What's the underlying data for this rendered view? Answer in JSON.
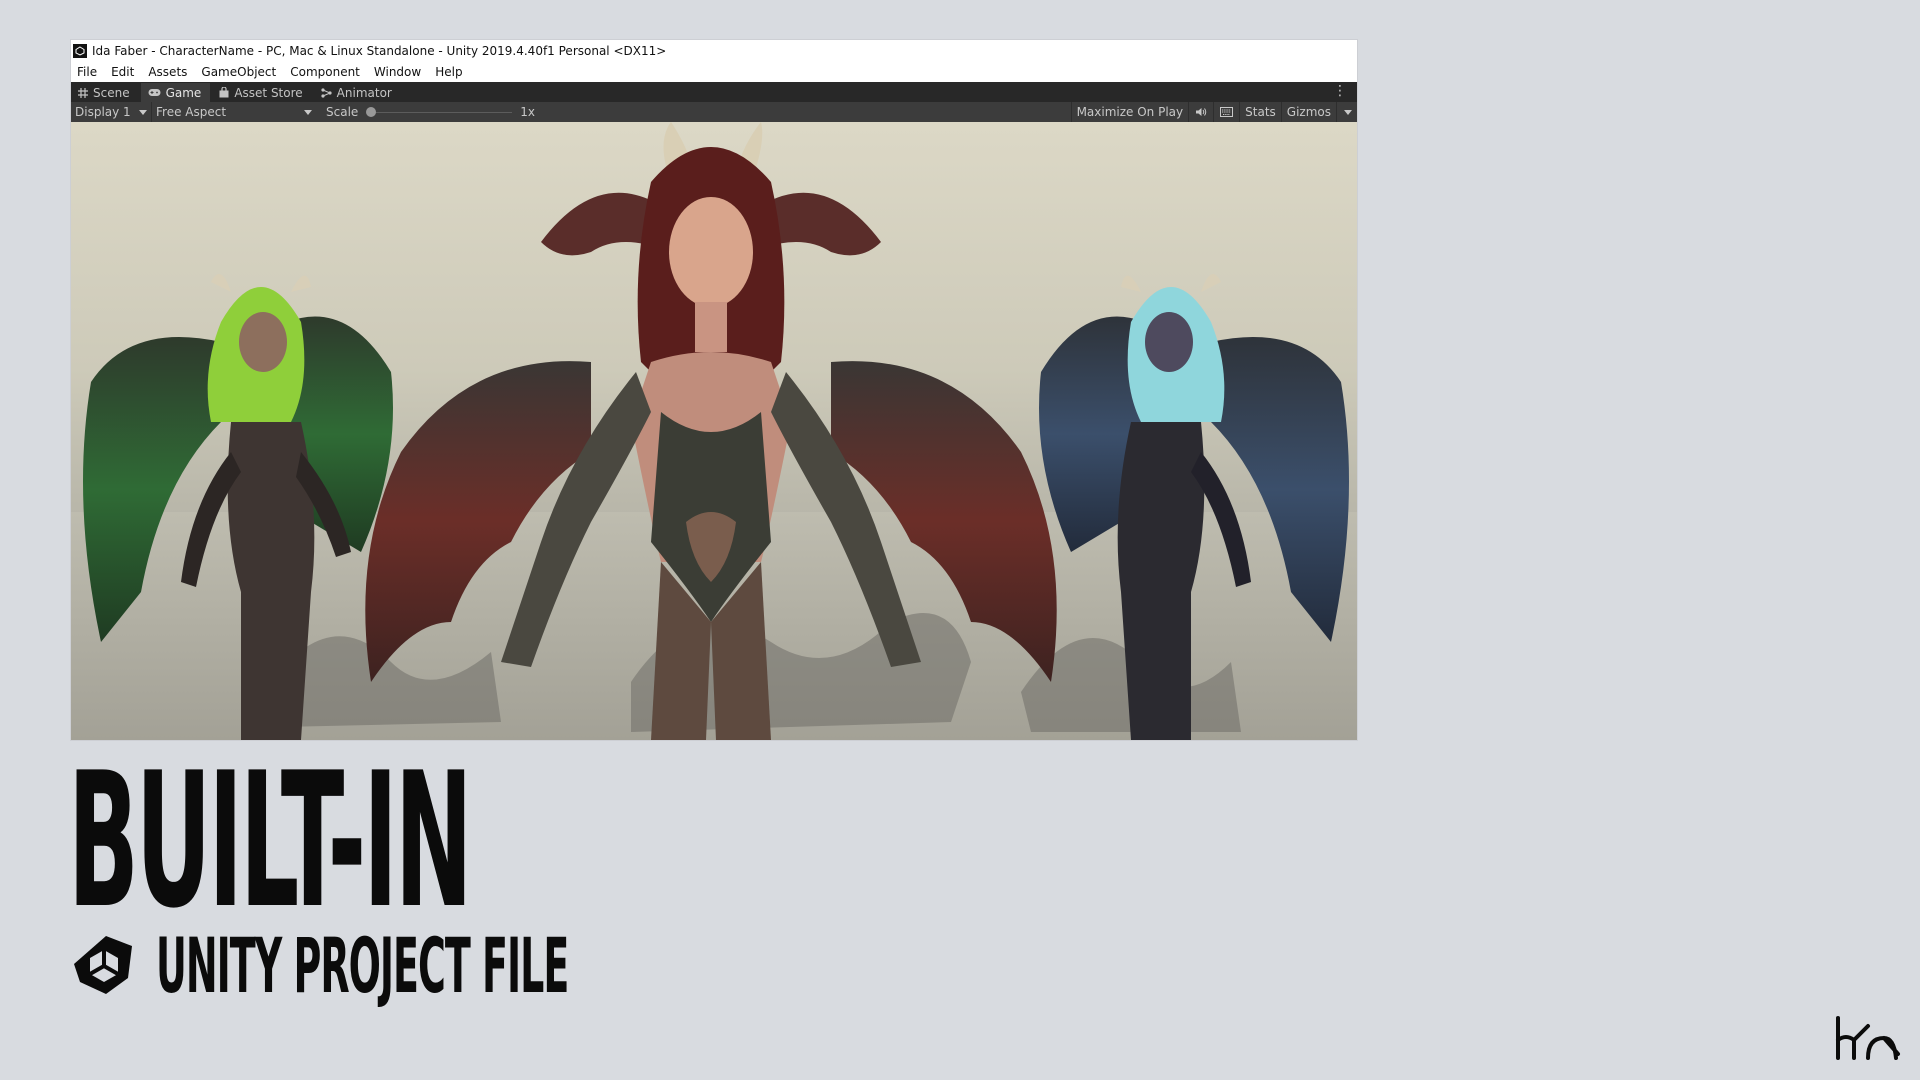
{
  "window": {
    "title": "Ida Faber - CharacterName - PC, Mac & Linux Standalone - Unity 2019.4.40f1 Personal <DX11>"
  },
  "menu": [
    "File",
    "Edit",
    "Assets",
    "GameObject",
    "Component",
    "Window",
    "Help"
  ],
  "tabs": [
    {
      "label": "Scene",
      "icon": "scene-grid-icon",
      "active": false
    },
    {
      "label": "Game",
      "icon": "gamepad-icon",
      "active": true
    },
    {
      "label": "Asset Store",
      "icon": "bag-icon",
      "active": false
    },
    {
      "label": "Animator",
      "icon": "animator-icon",
      "active": false
    }
  ],
  "toolbar": {
    "display": "Display 1",
    "aspect": "Free Aspect",
    "scale_label": "Scale",
    "scale_value": "1x",
    "maximize": "Maximize On Play",
    "stats": "Stats",
    "gizmos": "Gizmos"
  },
  "headline": "BUILT-IN",
  "subheadline": "UNITY PROJECT FILE",
  "colors": {
    "page_background": "#d8dbe0",
    "editor_dark": "#3c3c3c",
    "tab_bar": "#282828",
    "text_black": "#0b0b0b"
  }
}
